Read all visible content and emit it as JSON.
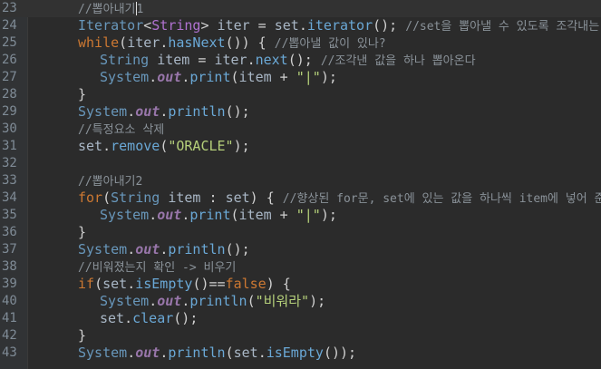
{
  "editor": {
    "lines": [
      {
        "n": "23",
        "indent": 1,
        "current": true,
        "tokens": [
          {
            "t": "//뽑아내기",
            "c": "cmt"
          },
          {
            "t": "",
            "c": "cursor"
          },
          {
            "t": "1",
            "c": "cmt"
          }
        ]
      },
      {
        "n": "24",
        "indent": 1,
        "tokens": [
          {
            "t": "Iterator",
            "c": "cls"
          },
          {
            "t": "<",
            "c": "punc"
          },
          {
            "t": "String",
            "c": "type"
          },
          {
            "t": "> ",
            "c": "punc"
          },
          {
            "t": "iter",
            "c": "var"
          },
          {
            "t": " = ",
            "c": "punc"
          },
          {
            "t": "set",
            "c": "var"
          },
          {
            "t": ".",
            "c": "punc"
          },
          {
            "t": "iterator",
            "c": "meth"
          },
          {
            "t": "(); ",
            "c": "punc"
          },
          {
            "t": "//set을 뽑아낼 수 있도록 조각내는 작업",
            "c": "cmt"
          }
        ]
      },
      {
        "n": "25",
        "indent": 1,
        "tokens": [
          {
            "t": "while",
            "c": "kw"
          },
          {
            "t": "(",
            "c": "punc"
          },
          {
            "t": "iter",
            "c": "var"
          },
          {
            "t": ".",
            "c": "punc"
          },
          {
            "t": "hasNext",
            "c": "meth"
          },
          {
            "t": "()) { ",
            "c": "punc"
          },
          {
            "t": "//뽑아낼 값이 있나?",
            "c": "cmt"
          }
        ]
      },
      {
        "n": "26",
        "indent": 2,
        "tokens": [
          {
            "t": "String",
            "c": "cls"
          },
          {
            "t": " ",
            "c": "punc"
          },
          {
            "t": "item",
            "c": "var"
          },
          {
            "t": " = ",
            "c": "punc"
          },
          {
            "t": "iter",
            "c": "var"
          },
          {
            "t": ".",
            "c": "punc"
          },
          {
            "t": "next",
            "c": "meth"
          },
          {
            "t": "(); ",
            "c": "punc"
          },
          {
            "t": "//조각낸 값을 하나 뽑아온다",
            "c": "cmt"
          }
        ]
      },
      {
        "n": "27",
        "indent": 2,
        "tokens": [
          {
            "t": "System",
            "c": "cls"
          },
          {
            "t": ".",
            "c": "punc"
          },
          {
            "t": "out",
            "c": "fld"
          },
          {
            "t": ".",
            "c": "punc"
          },
          {
            "t": "print",
            "c": "meth"
          },
          {
            "t": "(",
            "c": "punc"
          },
          {
            "t": "item",
            "c": "var"
          },
          {
            "t": " + ",
            "c": "punc"
          },
          {
            "t": "\"|\"",
            "c": "str"
          },
          {
            "t": ");",
            "c": "punc"
          }
        ]
      },
      {
        "n": "28",
        "indent": 1,
        "tokens": [
          {
            "t": "}",
            "c": "punc"
          }
        ]
      },
      {
        "n": "29",
        "indent": 1,
        "tokens": [
          {
            "t": "System",
            "c": "cls"
          },
          {
            "t": ".",
            "c": "punc"
          },
          {
            "t": "out",
            "c": "fld"
          },
          {
            "t": ".",
            "c": "punc"
          },
          {
            "t": "println",
            "c": "meth"
          },
          {
            "t": "();",
            "c": "punc"
          }
        ]
      },
      {
        "n": "30",
        "indent": 1,
        "tokens": [
          {
            "t": "//특정요소 삭제",
            "c": "cmt"
          }
        ]
      },
      {
        "n": "31",
        "indent": 1,
        "tokens": [
          {
            "t": "set",
            "c": "var"
          },
          {
            "t": ".",
            "c": "punc"
          },
          {
            "t": "remove",
            "c": "meth"
          },
          {
            "t": "(",
            "c": "punc"
          },
          {
            "t": "\"ORACLE\"",
            "c": "str"
          },
          {
            "t": ");",
            "c": "punc"
          }
        ]
      },
      {
        "n": "32",
        "indent": 1,
        "tokens": []
      },
      {
        "n": "33",
        "indent": 1,
        "tokens": [
          {
            "t": "//뽑아내기2",
            "c": "cmt"
          }
        ]
      },
      {
        "n": "34",
        "indent": 1,
        "tokens": [
          {
            "t": "for",
            "c": "kw"
          },
          {
            "t": "(",
            "c": "punc"
          },
          {
            "t": "String",
            "c": "cls"
          },
          {
            "t": " ",
            "c": "punc"
          },
          {
            "t": "item",
            "c": "var"
          },
          {
            "t": " : ",
            "c": "punc"
          },
          {
            "t": "set",
            "c": "var"
          },
          {
            "t": ") { ",
            "c": "punc"
          },
          {
            "t": "//향상된 for문, set에 있는 값을 하나씩 item에 넣어 준다",
            "c": "cmt"
          }
        ]
      },
      {
        "n": "35",
        "indent": 2,
        "tokens": [
          {
            "t": "System",
            "c": "cls"
          },
          {
            "t": ".",
            "c": "punc"
          },
          {
            "t": "out",
            "c": "fld"
          },
          {
            "t": ".",
            "c": "punc"
          },
          {
            "t": "print",
            "c": "meth"
          },
          {
            "t": "(",
            "c": "punc"
          },
          {
            "t": "item",
            "c": "var"
          },
          {
            "t": " + ",
            "c": "punc"
          },
          {
            "t": "\"|\"",
            "c": "str"
          },
          {
            "t": ");",
            "c": "punc"
          }
        ]
      },
      {
        "n": "36",
        "indent": 1,
        "tokens": [
          {
            "t": "}",
            "c": "punc"
          }
        ]
      },
      {
        "n": "37",
        "indent": 1,
        "tokens": [
          {
            "t": "System",
            "c": "cls"
          },
          {
            "t": ".",
            "c": "punc"
          },
          {
            "t": "out",
            "c": "fld"
          },
          {
            "t": ".",
            "c": "punc"
          },
          {
            "t": "println",
            "c": "meth"
          },
          {
            "t": "();",
            "c": "punc"
          }
        ]
      },
      {
        "n": "38",
        "indent": 1,
        "tokens": [
          {
            "t": "//비워졌는지 확인 -> 비우기",
            "c": "cmt"
          }
        ]
      },
      {
        "n": "39",
        "indent": 1,
        "tokens": [
          {
            "t": "if",
            "c": "kw"
          },
          {
            "t": "(",
            "c": "punc"
          },
          {
            "t": "set",
            "c": "var"
          },
          {
            "t": ".",
            "c": "punc"
          },
          {
            "t": "isEmpty",
            "c": "meth"
          },
          {
            "t": "()==",
            "c": "punc"
          },
          {
            "t": "false",
            "c": "kw"
          },
          {
            "t": ") {",
            "c": "punc"
          }
        ]
      },
      {
        "n": "40",
        "indent": 2,
        "tokens": [
          {
            "t": "System",
            "c": "cls"
          },
          {
            "t": ".",
            "c": "punc"
          },
          {
            "t": "out",
            "c": "fld"
          },
          {
            "t": ".",
            "c": "punc"
          },
          {
            "t": "println",
            "c": "meth"
          },
          {
            "t": "(",
            "c": "punc"
          },
          {
            "t": "\"비워라\"",
            "c": "str"
          },
          {
            "t": ");",
            "c": "punc"
          }
        ]
      },
      {
        "n": "41",
        "indent": 2,
        "tokens": [
          {
            "t": "set",
            "c": "var"
          },
          {
            "t": ".",
            "c": "punc"
          },
          {
            "t": "clear",
            "c": "meth"
          },
          {
            "t": "();",
            "c": "punc"
          }
        ]
      },
      {
        "n": "42",
        "indent": 1,
        "tokens": [
          {
            "t": "}",
            "c": "punc"
          }
        ]
      },
      {
        "n": "43",
        "indent": 1,
        "tokens": [
          {
            "t": "System",
            "c": "cls"
          },
          {
            "t": ".",
            "c": "punc"
          },
          {
            "t": "out",
            "c": "fld"
          },
          {
            "t": ".",
            "c": "punc"
          },
          {
            "t": "println",
            "c": "meth"
          },
          {
            "t": "(",
            "c": "punc"
          },
          {
            "t": "set",
            "c": "var"
          },
          {
            "t": ".",
            "c": "punc"
          },
          {
            "t": "isEmpty",
            "c": "meth"
          },
          {
            "t": "());",
            "c": "punc"
          }
        ]
      }
    ]
  }
}
